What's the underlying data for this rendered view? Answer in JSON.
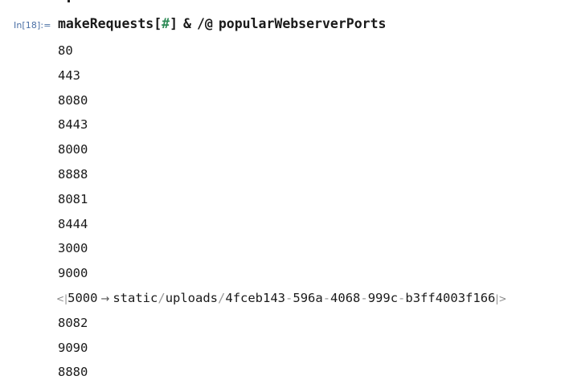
{
  "cell": {
    "label": "In[18]:="
  },
  "input": {
    "func_name": "makeRequests",
    "open_bracket": "[",
    "slot": "#",
    "close_bracket": "]",
    "amp": "&",
    "map_op": "/@",
    "arg": "popularWebserverPorts"
  },
  "outputs": [
    "80",
    "443",
    "8080",
    "8443",
    "8000",
    "8888",
    "8081",
    "8444",
    "3000",
    "9000"
  ],
  "association": {
    "open": "<|",
    "key": "5000",
    "arrow": "→",
    "path": [
      "static",
      "uploads",
      "4fceb143",
      "596a",
      "4068",
      "999c",
      "b3ff4003f166"
    ],
    "close": "|>"
  },
  "outputs_after": [
    "8082",
    "9090",
    "8880"
  ]
}
